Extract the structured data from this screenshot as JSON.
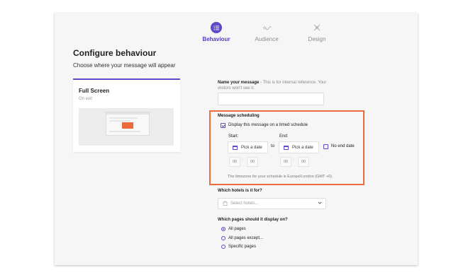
{
  "stepper": {
    "steps": [
      {
        "label": "Behaviour",
        "icon": "list-icon",
        "active": true
      },
      {
        "label": "Audience",
        "icon": "wave-icon",
        "active": false
      },
      {
        "label": "Design",
        "icon": "brush-icon",
        "active": false
      }
    ]
  },
  "page": {
    "title": "Configure behaviour",
    "subtitle": "Choose where your message will appear"
  },
  "card": {
    "title": "Full Screen",
    "subtitle": "On exit"
  },
  "form": {
    "name_label": "Name your message",
    "name_hint": " - This is for internal reference. Your visitors won't see it.",
    "name_value": "",
    "scheduling": {
      "title": "Message scheduling",
      "checkbox_label": "Display this message on a timed schedule",
      "checked": true,
      "start_label": "Start:",
      "end_label": "End:",
      "start_date_placeholder": "Pick a date",
      "end_date_placeholder": "Pick a date",
      "to_label": "to",
      "no_end_date_label": "No end date",
      "no_end_date_checked": false,
      "start_hour": "00",
      "start_minute": "00",
      "end_hour": "00",
      "end_minute": "00",
      "time_separator": ":",
      "timezone_note": "The timezone for your schedule is Europe/London (GMT +0)."
    },
    "hotels_label": "Which hotels is it for?",
    "hotels_placeholder": "Select hotels...",
    "pages_label": "Which pages should it display on?",
    "pages_options": [
      {
        "label": "All pages",
        "selected": true
      },
      {
        "label": "All pages except...",
        "selected": false
      },
      {
        "label": "Specific pages",
        "selected": false
      }
    ]
  },
  "colors": {
    "accent": "#5b4ac9",
    "highlight": "#ec6a3c"
  }
}
